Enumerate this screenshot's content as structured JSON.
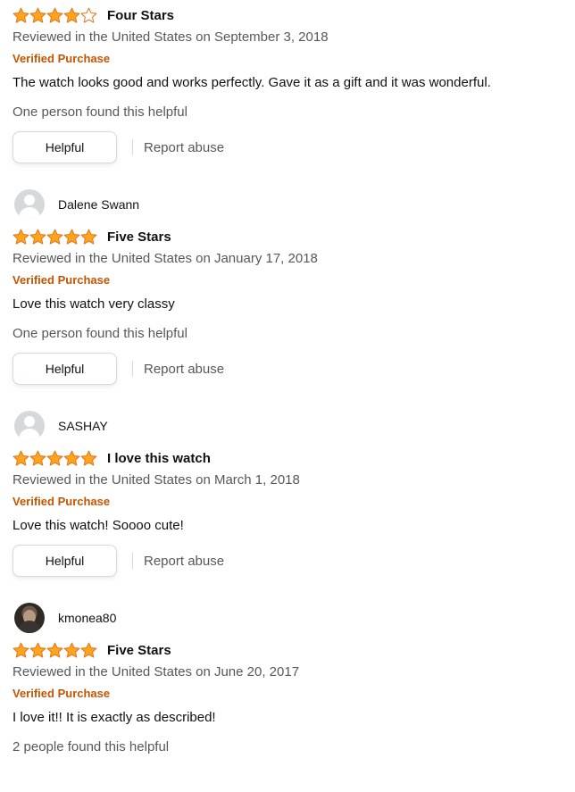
{
  "reviews": [
    {
      "reviewer": "",
      "rating": 4,
      "title": "Four Stars",
      "meta": "Reviewed in the United States on September 3, 2018",
      "verified": "Verified Purchase",
      "body": "The watch looks good and works perfectly. Gave it as a gift and it was wonderful.",
      "helpful_count": "One person found this helpful",
      "helpful_label": "Helpful",
      "report_label": "Report abuse"
    },
    {
      "reviewer": "Dalene Swann",
      "rating": 5,
      "title": "Five Stars",
      "meta": "Reviewed in the United States on January 17, 2018",
      "verified": "Verified Purchase",
      "body": "Love this watch very classy",
      "helpful_count": "One person found this helpful",
      "helpful_label": "Helpful",
      "report_label": "Report abuse"
    },
    {
      "reviewer": "SASHAY",
      "rating": 5,
      "title": "I love this watch",
      "meta": "Reviewed in the United States on March 1, 2018",
      "verified": "Verified Purchase",
      "body": "Love this watch! Soooo cute!",
      "helpful_count": "",
      "helpful_label": "Helpful",
      "report_label": "Report abuse"
    },
    {
      "reviewer": "kmonea80",
      "rating": 5,
      "title": "Five Stars",
      "meta": "Reviewed in the United States on June 20, 2017",
      "verified": "Verified Purchase",
      "body": "I love it!! It is exactly as described!",
      "helpful_count": "2 people found this helpful",
      "helpful_label": "",
      "report_label": ""
    }
  ],
  "colors": {
    "star_fill": "#ffa41c",
    "star_stroke": "#de7921",
    "verified": "#c45500",
    "meta_text": "#565959",
    "avatar_bg": "#d5d9d9"
  },
  "icons": {
    "star": "star-icon",
    "avatar": "default-avatar-icon",
    "avatar_photo": "user-photo-avatar"
  }
}
